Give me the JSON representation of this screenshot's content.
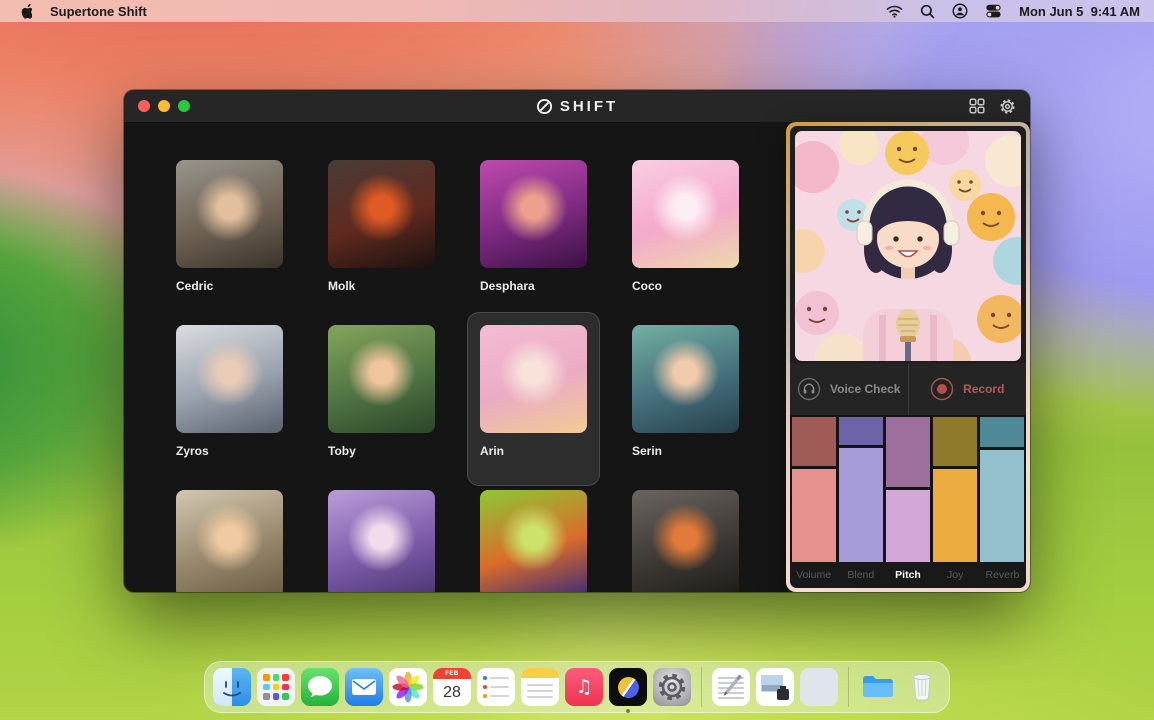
{
  "menu_bar": {
    "app_name": "Supertone Shift",
    "clock": "Mon Jun 5  9:41 AM",
    "status_icons": [
      "wifi-icon",
      "search-icon",
      "user-switch-icon",
      "control-center-icon"
    ]
  },
  "window": {
    "logo": "SHIFT",
    "toolbar_icons": [
      "grid-view-icon",
      "settings-icon"
    ]
  },
  "characters": [
    {
      "name": "Cedric",
      "selected": false,
      "palette": [
        "#98948c",
        "#6e6254",
        "#3a342c",
        "#e2c09e"
      ]
    },
    {
      "name": "Molk",
      "selected": false,
      "palette": [
        "#4a3c36",
        "#60291f",
        "#1a1210",
        "#e05a24"
      ]
    },
    {
      "name": "Desphara",
      "selected": false,
      "palette": [
        "#c04ab0",
        "#7c2a80",
        "#3c1144",
        "#eda08e"
      ]
    },
    {
      "name": "Coco",
      "selected": false,
      "palette": [
        "#f8cde2",
        "#f4aacb",
        "#ecd8ac",
        "#fdeef4"
      ]
    },
    {
      "name": "Zyros",
      "selected": false,
      "palette": [
        "#dadce0",
        "#9aa2ae",
        "#596170",
        "#e8ccb6"
      ]
    },
    {
      "name": "Toby",
      "selected": false,
      "palette": [
        "#85a45c",
        "#507444",
        "#2b4628",
        "#f0c49c"
      ]
    },
    {
      "name": "Arin",
      "selected": true,
      "palette": [
        "#f4bcd4",
        "#eaacc4",
        "#f2cb92",
        "#f9e2da"
      ]
    },
    {
      "name": "Serin",
      "selected": false,
      "palette": [
        "#72b0a0",
        "#46707e",
        "#27404c",
        "#f2cbaa"
      ]
    },
    {
      "name": "",
      "selected": false,
      "palette": [
        "#d2c7b0",
        "#97886c",
        "#695c44",
        "#f0caa2"
      ]
    },
    {
      "name": "",
      "selected": false,
      "palette": [
        "#bb9cda",
        "#7d5caa",
        "#4b3572",
        "#f2dcec"
      ]
    },
    {
      "name": "",
      "selected": false,
      "palette": [
        "#8cc934",
        "#d96c2a",
        "#3b2a7a",
        "#cce26a"
      ]
    },
    {
      "name": "",
      "selected": false,
      "palette": [
        "#6b6560",
        "#3d3935",
        "#1d1b19",
        "#e27a3a"
      ]
    }
  ],
  "panel": {
    "voice_check": "Voice Check",
    "record": "Record",
    "record_color": "#b8504a",
    "sliders": [
      {
        "label": "Volume",
        "value": 66,
        "fill": "#e5928e",
        "track": "#9f5b55",
        "active": false
      },
      {
        "label": "Blend",
        "value": 81,
        "fill": "#a79cda",
        "track": "#6c64a8",
        "active": false
      },
      {
        "label": "Pitch",
        "value": 52,
        "fill": "#d3a7d8",
        "track": "#9c6f9d",
        "active": true
      },
      {
        "label": "Joy",
        "value": 66,
        "fill": "#ecac3f",
        "track": "#8f7a2c",
        "active": false
      },
      {
        "label": "Reverb",
        "value": 79,
        "fill": "#93c0cd",
        "track": "#4f8896",
        "active": false
      }
    ]
  },
  "dock": {
    "items": [
      "finder",
      "launchpad",
      "messages",
      "mail",
      "photos",
      "calendar",
      "reminders",
      "notes",
      "music",
      "supertone-shift",
      "system-settings",
      "divider",
      "textedit",
      "image-document",
      "blank-document",
      "divider",
      "folder",
      "trash"
    ],
    "running": [
      "supertone-shift"
    ],
    "calendar": {
      "month": "FEB",
      "day": "28"
    }
  }
}
